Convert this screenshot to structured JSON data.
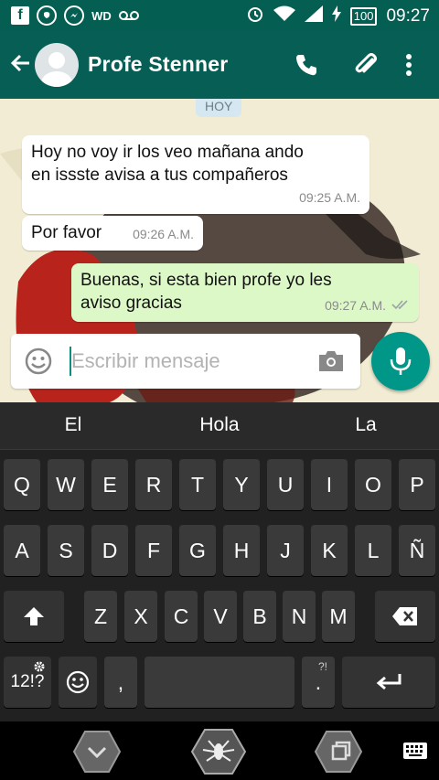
{
  "status_bar": {
    "left_icons": [
      "facebook-icon",
      "whatsapp-icon",
      "messenger-icon",
      "wp-icon",
      "voicemail-icon"
    ],
    "wp_label": "WD",
    "right_icons": [
      "alarm-icon",
      "wifi-icon",
      "signal-icon",
      "charging-icon"
    ],
    "battery": "100",
    "time": "09:27"
  },
  "app_bar": {
    "title": "Profe Stenner",
    "icons": [
      "back-arrow-icon",
      "avatar-icon",
      "phone-icon",
      "attach-icon",
      "more-vert-icon"
    ]
  },
  "chat": {
    "date_chip": "HOY",
    "messages": [
      {
        "direction": "in",
        "text_line1": "Hoy no voy ir los veo mañana ando",
        "text_line2": "en issste avisa a tus compañeros",
        "time": "09:25 A.M."
      },
      {
        "direction": "in",
        "text": "Por favor",
        "time": "09:26 A.M."
      },
      {
        "direction": "out",
        "text_line1": "Buenas, si esta bien profe yo les",
        "text_line2": "aviso gracias",
        "time": "09:27 A.M.",
        "status": "double-check-icon"
      }
    ]
  },
  "composer": {
    "placeholder": "Escribir mensaje",
    "icons": [
      "emoji-icon",
      "camera-icon",
      "mic-icon"
    ]
  },
  "keyboard": {
    "suggestions": [
      "El",
      "Hola",
      "La"
    ],
    "row1": [
      "Q",
      "W",
      "E",
      "R",
      "T",
      "Y",
      "U",
      "I",
      "O",
      "P"
    ],
    "row2": [
      "A",
      "S",
      "D",
      "F",
      "G",
      "H",
      "J",
      "K",
      "L",
      "Ñ"
    ],
    "row3": [
      "Z",
      "X",
      "C",
      "V",
      "B",
      "N",
      "M"
    ],
    "numbers_key": "12!?",
    "comma_key": ",",
    "period_key": ".",
    "period_sub": "?!",
    "icons": [
      "shift-icon",
      "backspace-icon",
      "settings-icon",
      "emoji-icon",
      "enter-icon"
    ]
  },
  "nav_bar": {
    "icons": [
      "back-chevron-icon",
      "home-spider-icon",
      "recents-icon",
      "keyboard-switch-icon"
    ]
  },
  "colors": {
    "status_bar": "#055e52",
    "app_bar": "#075e54",
    "outgoing_bubble": "#dcf8c6",
    "incoming_bubble": "#ffffff",
    "mic_button": "#009688",
    "keyboard_bg": "#212121"
  }
}
